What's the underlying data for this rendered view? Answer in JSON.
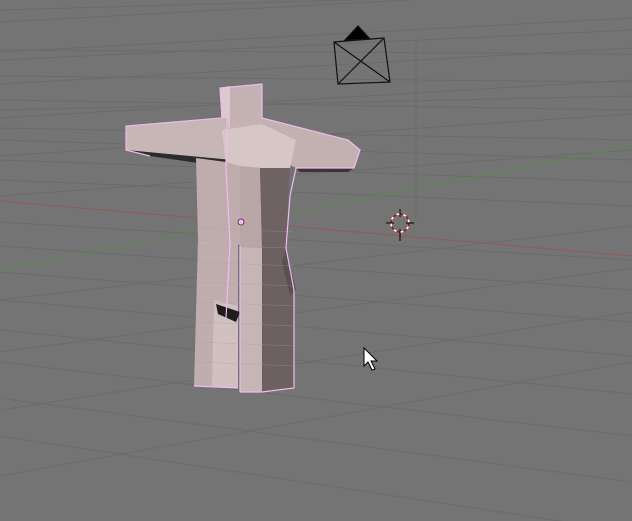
{
  "viewport": {
    "name": "3D View",
    "background": "#747474",
    "grid_color": "#6a6a6a",
    "x_axis_color": "#9a5656",
    "y_axis_color": "#5c8a4e"
  },
  "mesh": {
    "object": "humanoid-mesh",
    "mode": "edit",
    "face_color": "#c2b1b1",
    "shadow_color": "#3a3838",
    "selection_color": "#f3b9f3"
  },
  "scene": {
    "camera": "camera-object-icon",
    "cursor": "3d-cursor-icon",
    "pointer": "mouse-pointer-icon"
  }
}
